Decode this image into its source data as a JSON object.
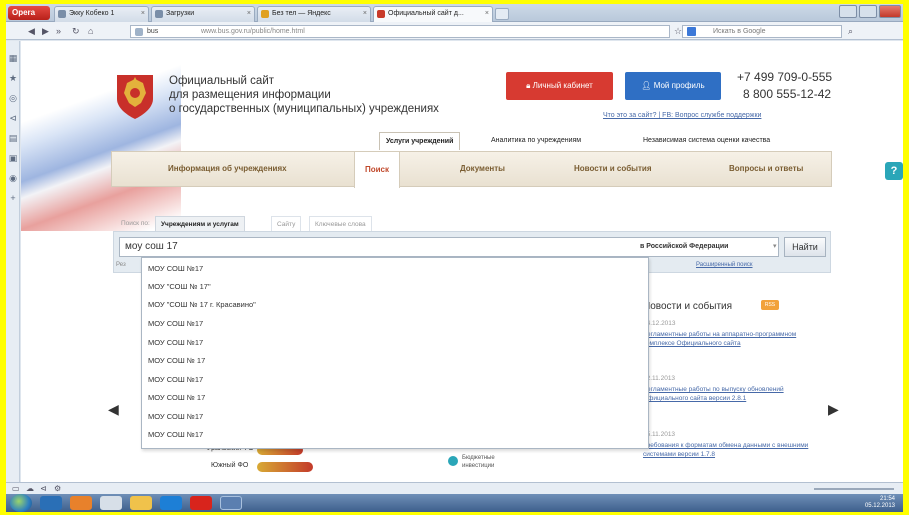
{
  "browser": {
    "opera_label": "Opera",
    "tabs": [
      {
        "title": "Экку Кобеко 1"
      },
      {
        "title": "Загрузки"
      },
      {
        "title": "Без тел — Яндекс"
      },
      {
        "title": "Официальный сайт д..."
      }
    ],
    "url_site": "bus",
    "url": "www.bus.gov.ru/public/home.html",
    "search_placeholder": "Искать в Google"
  },
  "header": {
    "title_line1": "Официальный сайт",
    "title_line2": "для размещения информации",
    "title_line3": "о государственных (муниципальных) учреждениях",
    "cabinet_button": "Личный кабинет",
    "profile_button": "Мой профиль",
    "phone1": "+7 499 709-0-555",
    "phone2": "8 800 555-12-42",
    "top_links": "Что это за сайт? | FB: Вопрос службе поддержки"
  },
  "subtabs": [
    {
      "label": "Услуги учреждений"
    },
    {
      "label": "Аналитика по учреждениям"
    },
    {
      "label": "Независимая система оценки качества"
    }
  ],
  "mainnav": [
    {
      "label": "Информация об учреждениях"
    },
    {
      "label": "Поиск"
    },
    {
      "label": "Документы"
    },
    {
      "label": "Новости и события"
    },
    {
      "label": "Вопросы и ответы"
    }
  ],
  "search": {
    "tabs_prefix": "Поиск по:",
    "tabs": [
      {
        "label": "Учреждениям и услугам"
      },
      {
        "label": "Сайту"
      },
      {
        "label": "Ключевые слова"
      }
    ],
    "query": "моу сош 17",
    "region": "в Российской Федерации",
    "find_button": "Найти",
    "advanced_link": "Расширенный поиск",
    "hint": "Рез"
  },
  "suggestions": [
    "МОУ СОШ №17",
    "МОУ \"СОШ № 17\"",
    "МОУ \"СОШ № 17 г. Красавино\"",
    "МОУ СОШ №17",
    "МОУ СОШ №17",
    "МОУ СОШ № 17",
    "МОУ СОШ №17",
    "МОУ СОШ № 17",
    "МОУ СОШ №17",
    "МОУ СОШ №17"
  ],
  "news": {
    "title": "Новости и события",
    "rss": "RSS",
    "items": [
      {
        "date": "04.12.2013",
        "text": "Регламентные работы на аппаратно-программном комплексе Официального сайта"
      },
      {
        "date": "22.11.2013",
        "text": "Регламентные работы по выпуску обновлений Официального сайта версии 2.8.1"
      },
      {
        "date": "15.11.2013",
        "text": "Требования к форматам обмена данными с внешними системами версии 1.7.8"
      }
    ]
  },
  "chart": {
    "rows": [
      {
        "label": "Уральский ФО"
      },
      {
        "label": "Южный ФО"
      }
    ],
    "legend": "Бюджетные инвестиции"
  },
  "taskbar": {
    "time": "21:54",
    "date": "05.12.2013"
  }
}
